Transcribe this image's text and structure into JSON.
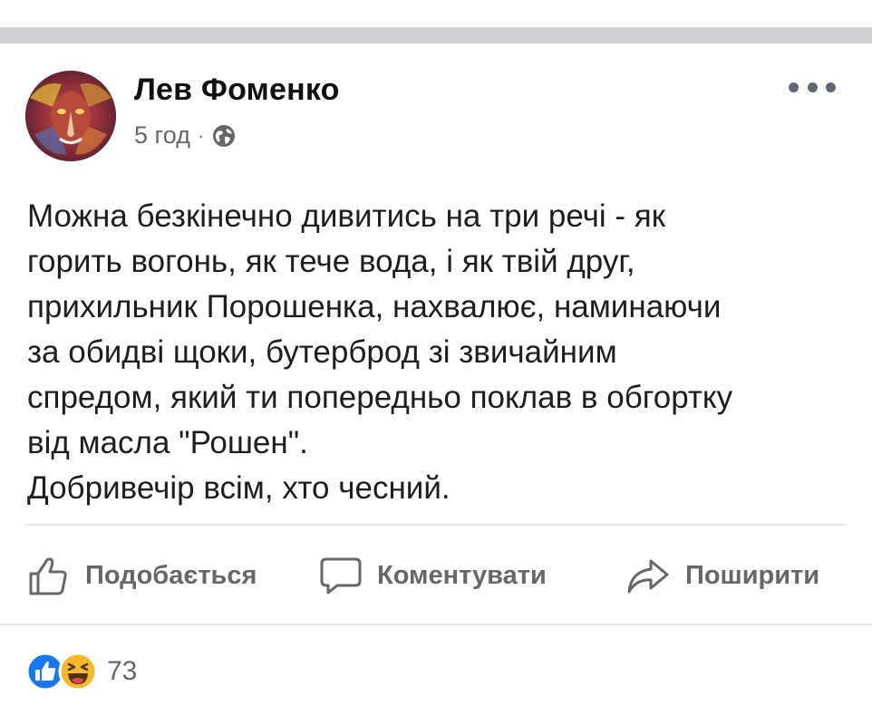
{
  "post": {
    "author": "Лев Фоменко",
    "time": "5 год",
    "separator": "·",
    "privacy_icon": "globe-icon",
    "menu_icon": "more-dots-icon",
    "text_lines": [
      "Можна безкінечно дивитись на три речі - як",
      "горить вогонь, як тече вода, і як твій друг,",
      "прихильник Порошенка, нахвалює, наминаючи",
      "за обидві щоки, бутерброд зі звичайним",
      "спредом, який ти попередньо поклав в обгортку",
      "від масла \"Рошен\".",
      "Добривечір всім, хто чесний."
    ]
  },
  "actions": {
    "like_label": "Подобається",
    "comment_label": "Коментувати",
    "share_label": "Поширити"
  },
  "reactions": {
    "icons": [
      "like-icon",
      "haha-icon"
    ],
    "count": "73"
  },
  "colors": {
    "text": "#1c1e21",
    "secondary": "#65676b",
    "divider": "#e4e6eb",
    "band": "#cfd1d5",
    "like_blue": "#1877f2",
    "haha_yellow": "#f7b928"
  }
}
